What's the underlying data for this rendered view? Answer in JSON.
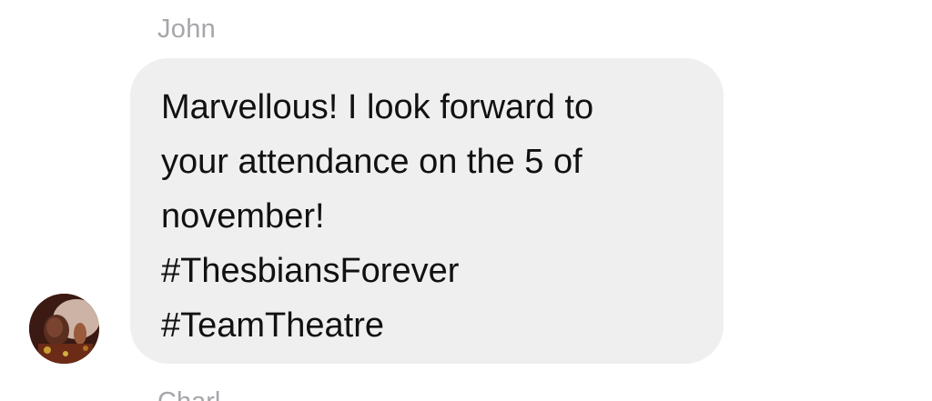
{
  "message": {
    "sender": "John",
    "lines": [
      "Marvellous! I look forward to",
      "your attendance on the 5 of",
      "november!",
      "#ThesbiansForever",
      "#TeamTheatre"
    ]
  },
  "colors": {
    "bubble": "#efeff0",
    "sender_text": "#a6a6aa",
    "message_text": "#111111"
  },
  "next_message": {
    "sender": "Charl"
  }
}
